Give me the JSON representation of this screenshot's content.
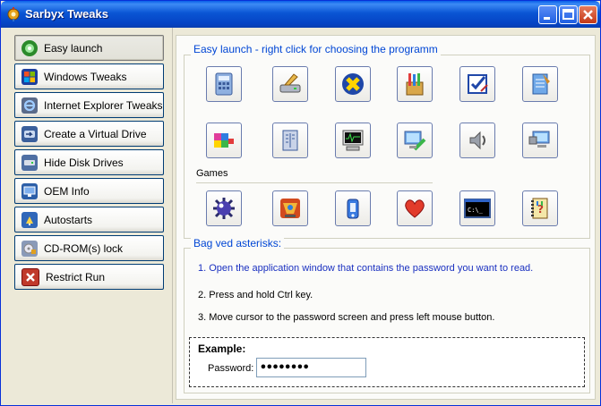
{
  "window": {
    "title": "Sarbyx Tweaks",
    "accent": "#0a55d4"
  },
  "sidebar": {
    "items": [
      {
        "label": "Easy launch",
        "icon": "easy-launch-icon",
        "active": true
      },
      {
        "label": "Windows Tweaks",
        "icon": "windows-logo-icon"
      },
      {
        "label": "Internet Explorer Tweaks",
        "icon": "internet-explorer-icon"
      },
      {
        "label": "Create a Virtual Drive",
        "icon": "virtual-drive-icon"
      },
      {
        "label": "Hide Disk Drives",
        "icon": "disk-drive-icon"
      },
      {
        "label": "OEM Info",
        "icon": "oem-info-icon"
      },
      {
        "label": "Autostarts",
        "icon": "autostart-icon"
      },
      {
        "label": "CD-ROM(s) lock",
        "icon": "cdrom-lock-icon"
      },
      {
        "label": "Restrict Run",
        "icon": "restrict-icon"
      }
    ]
  },
  "easy_launch": {
    "title": "Easy launch - right click for choosing the programm",
    "row1_icons": [
      "calculator-icon",
      "disk-cleanup-icon",
      "accessibility-icon",
      "paint-icon",
      "checklist-icon",
      "notepad-icon"
    ],
    "row2_icons": [
      "package-icon",
      "server-icon",
      "task-manager-icon",
      "display-properties-icon",
      "volume-icon",
      "network-icon"
    ],
    "games_label": "Games",
    "games_icons": [
      "minesweeper-icon",
      "pinball-icon",
      "freecell-icon",
      "hearts-icon",
      "command-prompt-icon",
      "help-book-icon"
    ]
  },
  "asterisks": {
    "title": "Bag ved asterisks:",
    "steps": [
      "1. Open the application window that contains the password you want to read.",
      "2. Press and hold Ctrl key.",
      "3. Move cursor to the password screen and press left mouse button."
    ],
    "example_title": "Example:",
    "password_label": "Password:",
    "password_value": "••••••••"
  }
}
